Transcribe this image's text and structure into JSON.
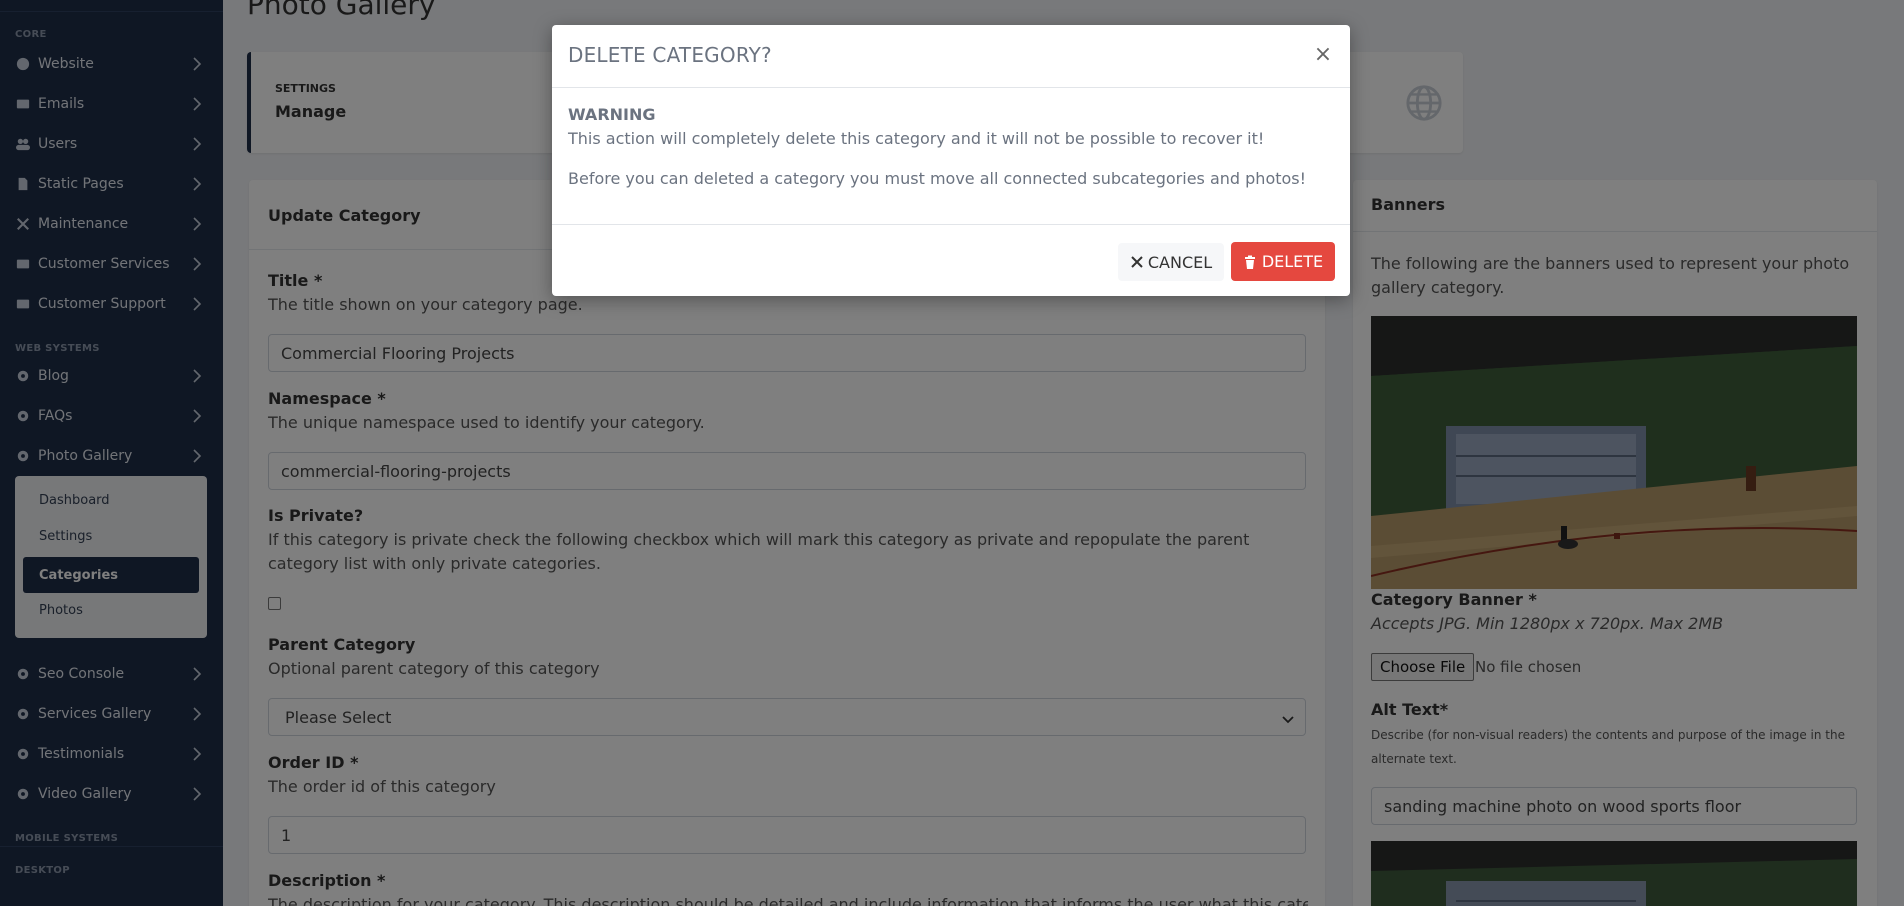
{
  "page": {
    "title": "Photo Gallery"
  },
  "sidebar": {
    "sections": {
      "core": "CORE",
      "web_systems": "WEB SYSTEMS",
      "mobile_systems": "MOBILE SYSTEMS",
      "desktop": "DESKTOP"
    },
    "items": {
      "website": "Website",
      "emails": "Emails",
      "users": "Users",
      "static_pages": "Static Pages",
      "maintenance": "Maintenance",
      "customer_services": "Customer Services",
      "customer_support": "Customer Support",
      "blog": "Blog",
      "faqs": "FAQs",
      "photo_gallery": "Photo Gallery",
      "seo_console": "Seo Console",
      "services_gallery": "Services Gallery",
      "testimonials": "Testimonials",
      "video_gallery": "Video Gallery"
    },
    "submenu": [
      "Dashboard",
      "Settings",
      "Categories",
      "Photos"
    ]
  },
  "stat": {
    "label": "SETTINGS",
    "value": "Manage"
  },
  "form": {
    "header": "Update Category",
    "title_label": "Title *",
    "title_help": "The title shown on your category page.",
    "title_value": "Commercial Flooring Projects",
    "namespace_label": "Namespace *",
    "namespace_help": "The unique namespace used to identify your category.",
    "namespace_value": "commercial-flooring-projects",
    "private_label": "Is Private?",
    "private_help": "If this category is private check the following checkbox which will mark this category as private and repopulate the parent category list with only private categories.",
    "parent_label": "Parent Category",
    "parent_help": "Optional parent category of this category",
    "parent_value": "Please Select",
    "order_label": "Order ID *",
    "order_help": "The order id of this category",
    "order_value": "1",
    "description_label": "Description *",
    "description_help": "The description for your category. This description should be detailed and include information that informs the user what this category is about."
  },
  "banners": {
    "header": "Banners",
    "intro": "The following are the banners used to represent your photo gallery category.",
    "banner_label": "Category Banner *",
    "banner_help": "Accepts JPG. Min 1280px x 720px. Max 2MB",
    "file_button": "Choose File",
    "file_status": "No file chosen",
    "alt_label": "Alt Text*",
    "alt_help": "Describe (for non-visual readers) the contents and purpose of the image in the alternate text.",
    "alt_value": "sanding machine photo on wood sports floor"
  },
  "modal": {
    "title": "DELETE CATEGORY?",
    "close": "×",
    "warning_title": "WARNING",
    "warning_line1": "This action will completely delete this category and it will not be possible to recover it!",
    "warning_line2": "Before you can deleted a category you must move all connected subcategories and photos!",
    "cancel_label": "CANCEL",
    "delete_label": "DELETE"
  },
  "colors": {
    "sidebar": "#1f2f49",
    "danger": "#e5483f",
    "accent": "#1f2f49"
  }
}
